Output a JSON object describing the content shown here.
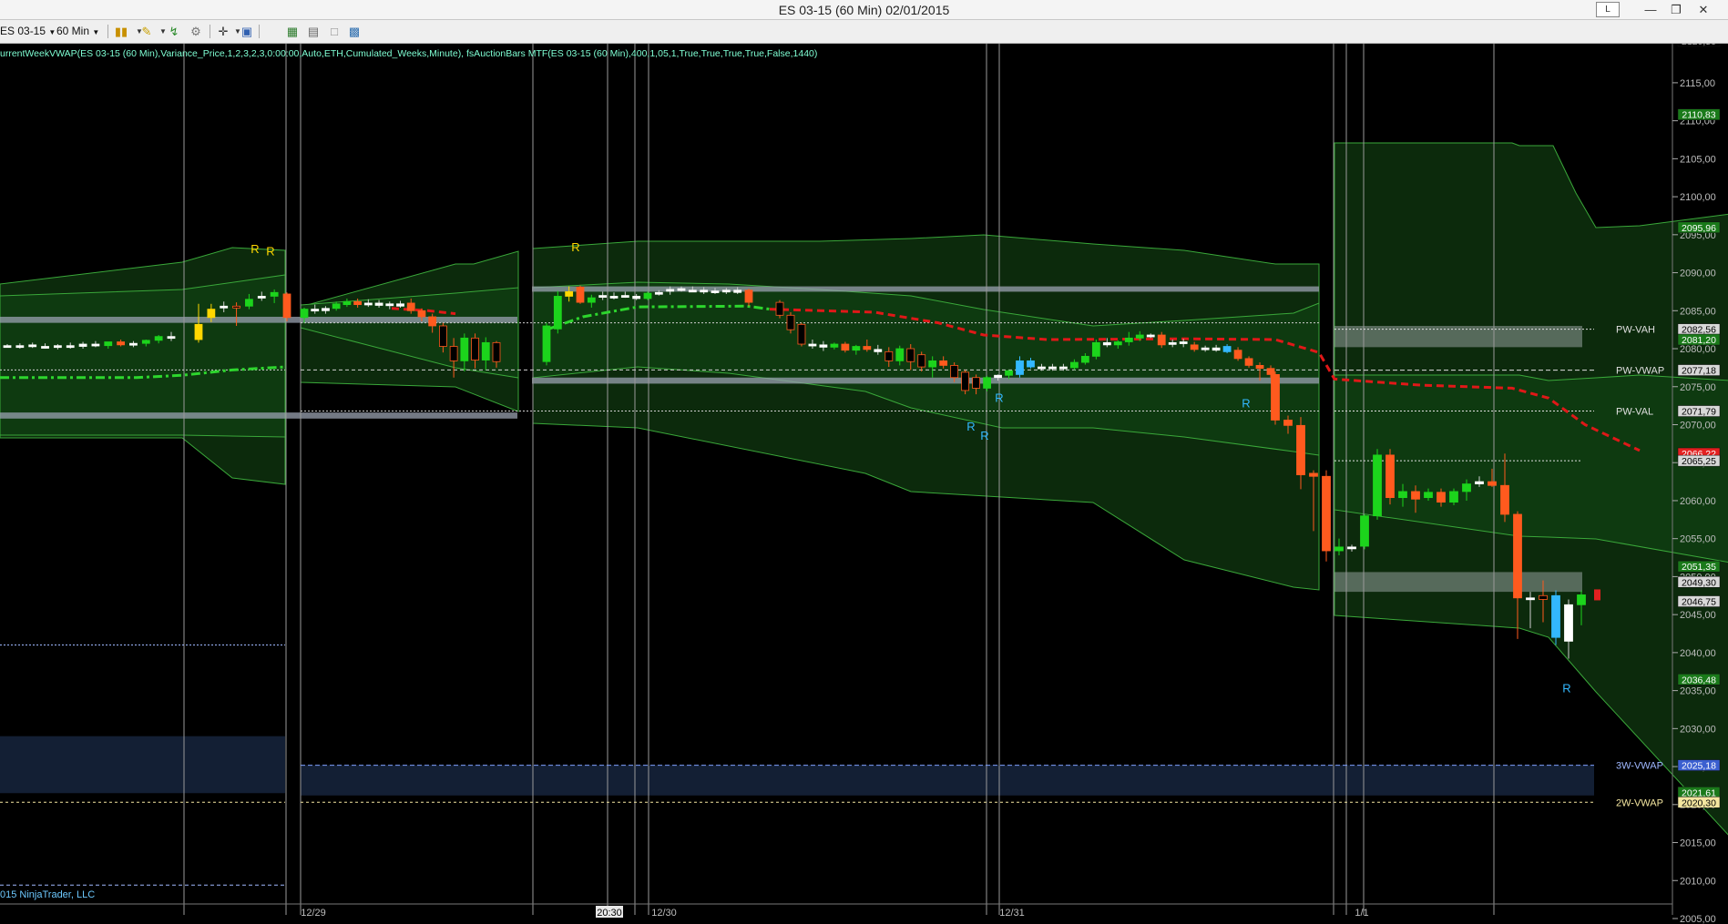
{
  "window": {
    "title": "ES 03-15 (60 Min)  02/01/2015",
    "lock_label": "L",
    "minimize_icon": "minimize-icon",
    "maximize_icon": "restore-icon",
    "close_icon": "close-icon"
  },
  "toolbar": {
    "instrument": "ES 03-15",
    "period": "60 Min",
    "icons": [
      "bar-style-icon",
      "drawing-pencil-icon",
      "indicator-icon",
      "strategy-icon",
      "crosshair-icon",
      "zoom-icon",
      "properties-icon",
      "chart-trader-icon",
      "data-box-icon",
      "template-icon"
    ]
  },
  "indicator_label": "urrentWeekVWAP(ES 03-15 (60 Min),Variance_Price,1,2,3,2,3,0:00:00,Auto,ETH,Cumulated_Weeks,Minute), fsAuctionBars MTF(ES 03-15 (60 Min),400,1,05,1,True,True,True,True,False,1440)",
  "copyright": "015 NinjaTrader, LLC",
  "chart_data": {
    "type": "candlestick",
    "ylim": [
      2005,
      2120.5
    ],
    "price_ticks": [
      "2120,50",
      "2115,00",
      "2110,00",
      "2105,00",
      "2100,00",
      "2095,00",
      "2090,00",
      "2085,00",
      "2080,00",
      "2075,00",
      "2070,00",
      "2065,00",
      "2060,00",
      "2055,00",
      "2050,00",
      "2045,00",
      "2040,00",
      "2035,00",
      "2030,00",
      "2025,00",
      "2020,00",
      "2015,00",
      "2010,00",
      "2005,00"
    ],
    "price_tick_values": [
      2120.5,
      2115,
      2110,
      2105,
      2100,
      2095,
      2090,
      2085,
      2080,
      2075,
      2070,
      2065,
      2060,
      2055,
      2050,
      2045,
      2040,
      2035,
      2030,
      2025,
      2020,
      2015,
      2010,
      2005
    ],
    "time_labels": [
      "12/29",
      "20:30",
      "12/30",
      "12/31",
      "1/1"
    ],
    "level_labels": [
      {
        "text": "PW-VAH",
        "price": 2082.56,
        "color": "#e0e0e0"
      },
      {
        "text": "PW-VWAP",
        "price": 2077.18,
        "color": "#e0e0e0"
      },
      {
        "text": "PW-VAL",
        "price": 2071.79,
        "color": "#e0e0e0"
      },
      {
        "text": "3W-VWAP",
        "price": 2025.18,
        "color": "#9fb8ff"
      },
      {
        "text": "2W-VWAP",
        "price": 2020.3,
        "color": "#f4e6a0"
      }
    ],
    "price_badges": [
      {
        "text": "2120,50",
        "price": 2120.5,
        "bg": "#000",
        "fg": "#bbb"
      },
      {
        "text": "2110,83",
        "price": 2110.83,
        "bg": "#1a7a1a",
        "fg": "#ffffff"
      },
      {
        "text": "2095,96",
        "price": 2095.96,
        "bg": "#1a7a1a",
        "fg": "#ffffff"
      },
      {
        "text": "2082,56",
        "price": 2082.56,
        "bg": "#d8d8d8",
        "fg": "#000"
      },
      {
        "text": "2081,20",
        "price": 2081.2,
        "bg": "#1a7a1a",
        "fg": "#ffffff"
      },
      {
        "text": "2077,18",
        "price": 2077.18,
        "bg": "#d8d8d8",
        "fg": "#000"
      },
      {
        "text": "2071,79",
        "price": 2071.79,
        "bg": "#d8d8d8",
        "fg": "#000"
      },
      {
        "text": "2066,22",
        "price": 2066.22,
        "bg": "#e32020",
        "fg": "#ffffff"
      },
      {
        "text": "2065,25",
        "price": 2065.25,
        "bg": "#d8d8d8",
        "fg": "#000"
      },
      {
        "text": "2051,35",
        "price": 2051.35,
        "bg": "#1a7a1a",
        "fg": "#ffffff"
      },
      {
        "text": "2049,30",
        "price": 2049.3,
        "bg": "#d8d8d8",
        "fg": "#000"
      },
      {
        "text": "2046,75",
        "price": 2046.75,
        "bg": "#d8d8d8",
        "fg": "#000"
      },
      {
        "text": "2036,48",
        "price": 2036.48,
        "bg": "#1a7a1a",
        "fg": "#ffffff"
      },
      {
        "text": "2025,18",
        "price": 2025.18,
        "bg": "#3a5fd0",
        "fg": "#ffffff"
      },
      {
        "text": "2021,61",
        "price": 2021.61,
        "bg": "#1a7a1a",
        "fg": "#ffffff"
      },
      {
        "text": "2020,30",
        "price": 2020.3,
        "bg": "#f4e6a0",
        "fg": "#000"
      }
    ],
    "markers": [
      "R",
      "R",
      "R",
      "R",
      "R",
      "R",
      "R",
      "R"
    ],
    "candles": [
      {
        "o": 2080.4,
        "h": 2080.6,
        "l": 2080.2,
        "c": 2080.4
      },
      {
        "o": 2080.4,
        "h": 2080.7,
        "l": 2080.0,
        "c": 2080.4
      },
      {
        "o": 2080.5,
        "h": 2080.8,
        "l": 2080.1,
        "c": 2080.3
      },
      {
        "o": 2080.3,
        "h": 2080.7,
        "l": 2080.0,
        "c": 2080.2
      },
      {
        "o": 2080.2,
        "h": 2080.6,
        "l": 2079.9,
        "c": 2080.4
      },
      {
        "o": 2080.4,
        "h": 2080.8,
        "l": 2080.0,
        "c": 2080.3
      },
      {
        "o": 2080.3,
        "h": 2080.9,
        "l": 2080.0,
        "c": 2080.6
      },
      {
        "o": 2080.6,
        "h": 2081.0,
        "l": 2080.2,
        "c": 2080.4
      },
      {
        "o": 2080.4,
        "h": 2080.8,
        "l": 2080.0,
        "c": 2080.9
      },
      {
        "o": 2080.9,
        "h": 2081.2,
        "l": 2080.3,
        "c": 2080.5
      },
      {
        "o": 2080.5,
        "h": 2081.0,
        "l": 2080.2,
        "c": 2080.7
      },
      {
        "o": 2080.7,
        "h": 2081.2,
        "l": 2080.3,
        "c": 2081.1
      },
      {
        "o": 2081.1,
        "h": 2081.8,
        "l": 2080.7,
        "c": 2081.6
      },
      {
        "o": 2081.6,
        "h": 2082.2,
        "l": 2081.0,
        "c": 2081.4
      },
      {
        "o": 2081.2,
        "h": 2085.9,
        "l": 2080.8,
        "c": 2083.2
      },
      {
        "o": 2084.1,
        "h": 2085.9,
        "l": 2083.5,
        "c": 2085.2
      },
      {
        "o": 2085.4,
        "h": 2086.2,
        "l": 2084.8,
        "c": 2085.6
      },
      {
        "o": 2085.6,
        "h": 2086.1,
        "l": 2083.0,
        "c": 2085.4
      },
      {
        "o": 2085.6,
        "h": 2087.2,
        "l": 2085.2,
        "c": 2086.5
      },
      {
        "o": 2086.9,
        "h": 2087.5,
        "l": 2086.3,
        "c": 2086.9
      },
      {
        "o": 2086.9,
        "h": 2087.8,
        "l": 2086.0,
        "c": 2087.4
      },
      {
        "o": 2087.2,
        "h": 2087.4,
        "l": 2083.6,
        "c": 2084.1
      },
      {
        "o": 2084.1,
        "h": 2085.4,
        "l": 2083.4,
        "c": 2085.2
      },
      {
        "o": 2085.2,
        "h": 2085.8,
        "l": 2084.6,
        "c": 2085.0
      },
      {
        "o": 2085.0,
        "h": 2085.6,
        "l": 2084.6,
        "c": 2085.3
      },
      {
        "o": 2085.3,
        "h": 2086.2,
        "l": 2085.0,
        "c": 2085.9
      },
      {
        "o": 2085.8,
        "h": 2086.6,
        "l": 2085.5,
        "c": 2086.2
      },
      {
        "o": 2086.2,
        "h": 2086.6,
        "l": 2085.4,
        "c": 2085.8
      },
      {
        "o": 2085.8,
        "h": 2086.5,
        "l": 2085.5,
        "c": 2086.0
      },
      {
        "o": 2086.0,
        "h": 2086.4,
        "l": 2085.4,
        "c": 2085.7
      },
      {
        "o": 2085.7,
        "h": 2086.2,
        "l": 2085.2,
        "c": 2085.9
      },
      {
        "o": 2085.9,
        "h": 2086.3,
        "l": 2085.4,
        "c": 2085.6
      },
      {
        "o": 2086.0,
        "h": 2086.6,
        "l": 2084.6,
        "c": 2085.0
      },
      {
        "o": 2085.0,
        "h": 2085.3,
        "l": 2083.6,
        "c": 2084.2
      },
      {
        "o": 2084.2,
        "h": 2084.6,
        "l": 2082.1,
        "c": 2083.0
      },
      {
        "o": 2083.0,
        "h": 2083.4,
        "l": 2079.5,
        "c": 2080.3
      },
      {
        "o": 2080.3,
        "h": 2081.4,
        "l": 2076.2,
        "c": 2078.4
      },
      {
        "o": 2078.4,
        "h": 2082.0,
        "l": 2077.0,
        "c": 2081.4
      },
      {
        "o": 2081.4,
        "h": 2082.0,
        "l": 2077.4,
        "c": 2078.5
      },
      {
        "o": 2078.5,
        "h": 2081.5,
        "l": 2077.2,
        "c": 2080.8
      },
      {
        "o": 2080.8,
        "h": 2081.0,
        "l": 2077.5,
        "c": 2078.3
      },
      {
        "o": 2078.3,
        "h": 2083.4,
        "l": 2077.8,
        "c": 2083.0
      },
      {
        "o": 2082.6,
        "h": 2087.6,
        "l": 2082.0,
        "c": 2086.9
      },
      {
        "o": 2086.9,
        "h": 2088.2,
        "l": 2086.2,
        "c": 2087.5
      },
      {
        "o": 2088.1,
        "h": 2088.3,
        "l": 2085.9,
        "c": 2086.1
      },
      {
        "o": 2086.1,
        "h": 2087.1,
        "l": 2085.4,
        "c": 2086.7
      },
      {
        "o": 2087.0,
        "h": 2087.5,
        "l": 2086.4,
        "c": 2086.8
      },
      {
        "o": 2086.8,
        "h": 2087.4,
        "l": 2086.5,
        "c": 2086.9
      },
      {
        "o": 2087.0,
        "h": 2087.5,
        "l": 2086.7,
        "c": 2086.9
      },
      {
        "o": 2086.9,
        "h": 2087.2,
        "l": 2086.4,
        "c": 2086.6
      },
      {
        "o": 2086.6,
        "h": 2087.5,
        "l": 2086.4,
        "c": 2087.3
      },
      {
        "o": 2087.3,
        "h": 2087.7,
        "l": 2087.0,
        "c": 2087.4
      },
      {
        "o": 2087.6,
        "h": 2088.2,
        "l": 2087.1,
        "c": 2087.8
      },
      {
        "o": 2087.8,
        "h": 2088.2,
        "l": 2087.5,
        "c": 2087.9
      },
      {
        "o": 2087.7,
        "h": 2088.2,
        "l": 2087.5,
        "c": 2087.7
      },
      {
        "o": 2087.7,
        "h": 2088.1,
        "l": 2087.2,
        "c": 2087.6
      },
      {
        "o": 2087.6,
        "h": 2088.0,
        "l": 2087.2,
        "c": 2087.5
      },
      {
        "o": 2087.5,
        "h": 2088.0,
        "l": 2087.2,
        "c": 2087.7
      },
      {
        "o": 2087.7,
        "h": 2088.1,
        "l": 2087.2,
        "c": 2087.4
      },
      {
        "o": 2087.7,
        "h": 2087.9,
        "l": 2085.6,
        "c": 2086.1
      },
      {
        "o": 2086.1,
        "h": 2086.4,
        "l": 2084.0,
        "c": 2084.4
      },
      {
        "o": 2084.4,
        "h": 2084.8,
        "l": 2082.0,
        "c": 2082.5
      },
      {
        "o": 2083.2,
        "h": 2083.4,
        "l": 2080.3,
        "c": 2080.6
      },
      {
        "o": 2080.6,
        "h": 2081.2,
        "l": 2080.0,
        "c": 2080.5
      },
      {
        "o": 2080.5,
        "h": 2081.0,
        "l": 2079.7,
        "c": 2080.2
      },
      {
        "o": 2080.2,
        "h": 2080.8,
        "l": 2079.9,
        "c": 2080.6
      },
      {
        "o": 2080.6,
        "h": 2080.9,
        "l": 2079.5,
        "c": 2079.8
      },
      {
        "o": 2079.8,
        "h": 2080.5,
        "l": 2079.2,
        "c": 2080.3
      },
      {
        "o": 2080.3,
        "h": 2081.2,
        "l": 2079.6,
        "c": 2079.9
      },
      {
        "o": 2079.9,
        "h": 2080.5,
        "l": 2079.2,
        "c": 2079.6
      },
      {
        "o": 2079.6,
        "h": 2080.2,
        "l": 2077.6,
        "c": 2078.4
      },
      {
        "o": 2078.4,
        "h": 2080.4,
        "l": 2077.8,
        "c": 2080.0
      },
      {
        "o": 2080.0,
        "h": 2080.6,
        "l": 2077.2,
        "c": 2078.3
      },
      {
        "o": 2079.2,
        "h": 2079.6,
        "l": 2077.0,
        "c": 2077.6
      },
      {
        "o": 2077.6,
        "h": 2079.0,
        "l": 2076.2,
        "c": 2078.4
      },
      {
        "o": 2078.4,
        "h": 2079.0,
        "l": 2077.4,
        "c": 2077.8
      },
      {
        "o": 2077.8,
        "h": 2078.2,
        "l": 2075.6,
        "c": 2076.2
      },
      {
        "o": 2076.9,
        "h": 2077.2,
        "l": 2074.0,
        "c": 2074.5
      },
      {
        "o": 2076.2,
        "h": 2076.6,
        "l": 2074.0,
        "c": 2074.8
      },
      {
        "o": 2074.8,
        "h": 2076.4,
        "l": 2074.4,
        "c": 2076.2
      },
      {
        "o": 2076.2,
        "h": 2076.6,
        "l": 2075.8,
        "c": 2076.5
      },
      {
        "o": 2076.5,
        "h": 2077.2,
        "l": 2076.0,
        "c": 2077.1
      },
      {
        "o": 2076.6,
        "h": 2079.0,
        "l": 2076.2,
        "c": 2078.4
      },
      {
        "o": 2078.4,
        "h": 2078.8,
        "l": 2077.4,
        "c": 2077.6
      },
      {
        "o": 2077.6,
        "h": 2078.0,
        "l": 2077.1,
        "c": 2077.5
      },
      {
        "o": 2077.5,
        "h": 2078.0,
        "l": 2077.1,
        "c": 2077.6
      },
      {
        "o": 2077.6,
        "h": 2078.0,
        "l": 2077.1,
        "c": 2077.5
      },
      {
        "o": 2077.5,
        "h": 2078.6,
        "l": 2077.2,
        "c": 2078.2
      },
      {
        "o": 2078.2,
        "h": 2079.4,
        "l": 2077.9,
        "c": 2079.0
      },
      {
        "o": 2079.0,
        "h": 2081.2,
        "l": 2078.6,
        "c": 2080.8
      },
      {
        "o": 2080.8,
        "h": 2081.4,
        "l": 2080.2,
        "c": 2080.5
      },
      {
        "o": 2080.5,
        "h": 2081.1,
        "l": 2080.0,
        "c": 2080.9
      },
      {
        "o": 2080.9,
        "h": 2082.2,
        "l": 2080.4,
        "c": 2081.4
      },
      {
        "o": 2081.4,
        "h": 2082.3,
        "l": 2081.0,
        "c": 2081.8
      },
      {
        "o": 2081.8,
        "h": 2082.0,
        "l": 2081.4,
        "c": 2081.6
      },
      {
        "o": 2081.8,
        "h": 2082.2,
        "l": 2080.1,
        "c": 2080.5
      },
      {
        "o": 2080.8,
        "h": 2081.2,
        "l": 2080.2,
        "c": 2080.7
      },
      {
        "o": 2080.7,
        "h": 2081.3,
        "l": 2080.2,
        "c": 2080.9
      },
      {
        "o": 2080.5,
        "h": 2080.9,
        "l": 2079.6,
        "c": 2079.9
      },
      {
        "o": 2079.9,
        "h": 2080.4,
        "l": 2079.6,
        "c": 2080.1
      },
      {
        "o": 2080.1,
        "h": 2080.5,
        "l": 2079.6,
        "c": 2079.8
      },
      {
        "o": 2080.3,
        "h": 2080.6,
        "l": 2079.4,
        "c": 2079.6
      },
      {
        "o": 2079.8,
        "h": 2080.2,
        "l": 2078.4,
        "c": 2078.7
      },
      {
        "o": 2078.7,
        "h": 2079.0,
        "l": 2077.5,
        "c": 2077.8
      },
      {
        "o": 2077.8,
        "h": 2078.2,
        "l": 2075.8,
        "c": 2077.4
      },
      {
        "o": 2077.4,
        "h": 2077.8,
        "l": 2076.2,
        "c": 2076.6
      },
      {
        "o": 2076.6,
        "h": 2077.0,
        "l": 2070.0,
        "c": 2070.6
      },
      {
        "o": 2070.6,
        "h": 2071.2,
        "l": 2068.8,
        "c": 2069.9
      },
      {
        "o": 2069.9,
        "h": 2071.0,
        "l": 2061.5,
        "c": 2063.4
      },
      {
        "o": 2063.6,
        "h": 2064.0,
        "l": 2056.0,
        "c": 2063.2
      },
      {
        "o": 2063.2,
        "h": 2064.0,
        "l": 2052.0,
        "c": 2053.4
      },
      {
        "o": 2053.4,
        "h": 2055.0,
        "l": 2052.8,
        "c": 2053.9
      },
      {
        "o": 2053.9,
        "h": 2054.2,
        "l": 2053.3,
        "c": 2053.7
      },
      {
        "o": 2054.0,
        "h": 2058.2,
        "l": 2053.6,
        "c": 2058.0
      },
      {
        "o": 2058.0,
        "h": 2066.8,
        "l": 2057.5,
        "c": 2066.0
      },
      {
        "o": 2066.0,
        "h": 2066.8,
        "l": 2059.5,
        "c": 2060.4
      },
      {
        "o": 2060.4,
        "h": 2062.2,
        "l": 2059.2,
        "c": 2061.2
      },
      {
        "o": 2061.2,
        "h": 2062.0,
        "l": 2058.4,
        "c": 2060.2
      },
      {
        "o": 2060.4,
        "h": 2061.6,
        "l": 2060.0,
        "c": 2061.1
      },
      {
        "o": 2061.1,
        "h": 2061.6,
        "l": 2059.2,
        "c": 2059.8
      },
      {
        "o": 2059.8,
        "h": 2061.6,
        "l": 2059.4,
        "c": 2061.2
      },
      {
        "o": 2061.2,
        "h": 2062.8,
        "l": 2060.0,
        "c": 2062.2
      },
      {
        "o": 2062.2,
        "h": 2063.2,
        "l": 2061.8,
        "c": 2062.5
      },
      {
        "o": 2062.5,
        "h": 2064.2,
        "l": 2061.8,
        "c": 2062.0
      },
      {
        "o": 2062.0,
        "h": 2066.2,
        "l": 2057.2,
        "c": 2058.2
      },
      {
        "o": 2058.2,
        "h": 2058.6,
        "l": 2041.8,
        "c": 2047.2
      },
      {
        "o": 2047.2,
        "h": 2048.0,
        "l": 2043.2,
        "c": 2047.0
      },
      {
        "o": 2047.0,
        "h": 2049.5,
        "l": 2044.0,
        "c": 2047.5
      },
      {
        "o": 2047.5,
        "h": 2048.2,
        "l": 2041.0,
        "c": 2042.0
      },
      {
        "o": 2041.5,
        "h": 2047.0,
        "l": 2039.2,
        "c": 2046.3
      },
      {
        "o": 2046.3,
        "h": 2048.2,
        "l": 2043.6,
        "c": 2047.6
      }
    ]
  }
}
